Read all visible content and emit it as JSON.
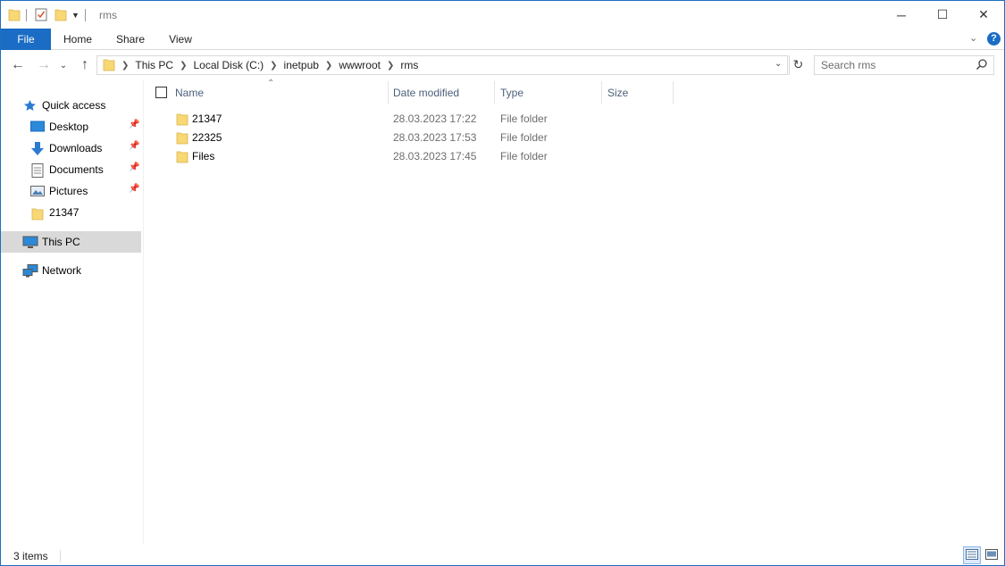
{
  "window": {
    "title": "rms",
    "controls": {
      "minimize": "─",
      "maximize": "☐",
      "close": "✕"
    }
  },
  "ribbon": {
    "tabs": [
      "File",
      "Home",
      "Share",
      "View"
    ],
    "help": "?"
  },
  "address": {
    "breadcrumbs": [
      "This PC",
      "Local Disk (C:)",
      "inetpub",
      "wwwroot",
      "rms"
    ]
  },
  "search": {
    "placeholder": "Search rms"
  },
  "nav": {
    "quick_access": "Quick access",
    "pinned": [
      {
        "label": "Desktop",
        "icon": "desktop-icon",
        "pinned": true
      },
      {
        "label": "Downloads",
        "icon": "downloads-icon",
        "pinned": true
      },
      {
        "label": "Documents",
        "icon": "documents-icon",
        "pinned": true
      },
      {
        "label": "Pictures",
        "icon": "pictures-icon",
        "pinned": true
      },
      {
        "label": "21347",
        "icon": "folder-icon",
        "pinned": false
      }
    ],
    "this_pc": "This PC",
    "network": "Network"
  },
  "columns": {
    "name": "Name",
    "date": "Date modified",
    "type": "Type",
    "size": "Size"
  },
  "files": [
    {
      "name": "21347",
      "date": "28.03.2023 17:22",
      "type": "File folder",
      "size": ""
    },
    {
      "name": "22325",
      "date": "28.03.2023 17:53",
      "type": "File folder",
      "size": ""
    },
    {
      "name": "Files",
      "date": "28.03.2023 17:45",
      "type": "File folder",
      "size": ""
    }
  ],
  "status": {
    "count": "3 items"
  },
  "colors": {
    "accent": "#1a6cc4",
    "folder": "#f8d775",
    "selected_nav": "#d9d9d9",
    "header_text": "#4c607a"
  }
}
